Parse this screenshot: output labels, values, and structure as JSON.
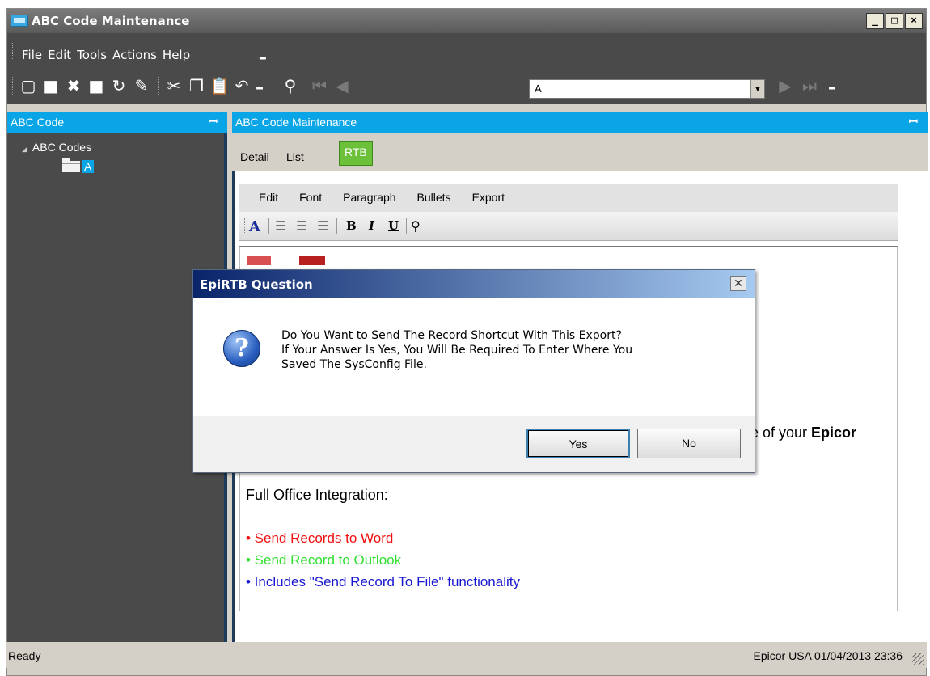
{
  "window": {
    "title": "ABC Code Maintenance"
  },
  "menu": {
    "items": [
      "File",
      "Edit",
      "Tools",
      "Actions",
      "Help"
    ]
  },
  "toolbar": {
    "search_value": "A"
  },
  "left_panel": {
    "header": "ABC Code",
    "tree_root": "ABC Codes",
    "tree_child": "A"
  },
  "right_panel": {
    "header": "ABC Code Maintenance",
    "tabs": [
      {
        "label": "Detail"
      },
      {
        "label": "List"
      },
      {
        "label": "RTB",
        "active": true
      }
    ]
  },
  "rtb": {
    "menu": [
      "Edit",
      "Font",
      "Paragraph",
      "Bullets",
      "Export"
    ],
    "doc": {
      "partial_text": "e of your ",
      "partial_bold": "Epicor",
      "heading": "Full Office Integration:",
      "bullets": [
        {
          "text": "• Send Records to Word",
          "color": "#f01010"
        },
        {
          "text": "• Send Record to Outlook",
          "color": "#30e030"
        },
        {
          "text": "• Includes \"Send Record To File\" functionality",
          "color": "#1818d0"
        }
      ]
    }
  },
  "dialog": {
    "title": "EpiRTB Question",
    "message": [
      "Do You Want to Send The Record Shortcut With This Export?",
      "If Your Answer Is Yes, You Will Be Required To Enter Where You",
      "Saved The SysConfig File."
    ],
    "yes_label": "Yes",
    "no_label": "No"
  },
  "status": {
    "left": "Ready",
    "right": "Epicor USA  01/04/2013   23:36"
  },
  "colors": {
    "accent": "#0aa5e6",
    "tab_active": "#6cc03a",
    "dark_panel": "#4a4a4a"
  }
}
